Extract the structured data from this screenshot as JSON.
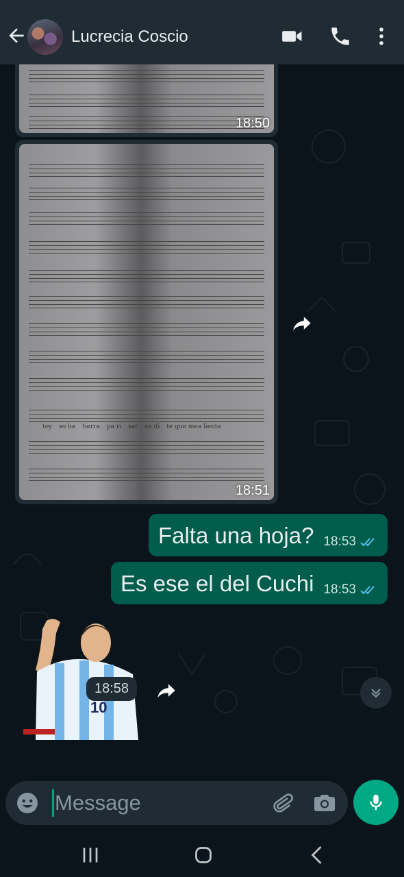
{
  "header": {
    "contact_name": "Lucrecia Coscio",
    "icons": [
      "back-arrow-icon",
      "video-call-icon",
      "voice-call-icon",
      "more-options-icon"
    ]
  },
  "messages": [
    {
      "type": "image",
      "direction": "incoming",
      "time": "18:50"
    },
    {
      "type": "image",
      "direction": "incoming",
      "time": "18:51",
      "lyrics": [
        "toy",
        "so ba",
        "tierra",
        "pa ri",
        "sar",
        "ce di",
        "te que mea lienta"
      ]
    },
    {
      "type": "text",
      "direction": "outgoing",
      "text": "Falta una hoja?",
      "time": "18:53",
      "status": "read"
    },
    {
      "type": "text",
      "direction": "outgoing",
      "text": "Es ese el del Cuchi",
      "time": "18:53",
      "status": "read"
    },
    {
      "type": "sticker",
      "direction": "incoming",
      "time": "18:58",
      "jersey_number": "10"
    }
  ],
  "composer": {
    "placeholder": "Message",
    "icons": [
      "emoji-icon",
      "attach-icon",
      "camera-icon",
      "mic-icon"
    ]
  },
  "colors": {
    "header_bg": "#1f2c34",
    "chat_bg": "#0b141a",
    "outgoing_bubble": "#005c4b",
    "accent": "#00a884",
    "read_ticks": "#53bdeb"
  }
}
